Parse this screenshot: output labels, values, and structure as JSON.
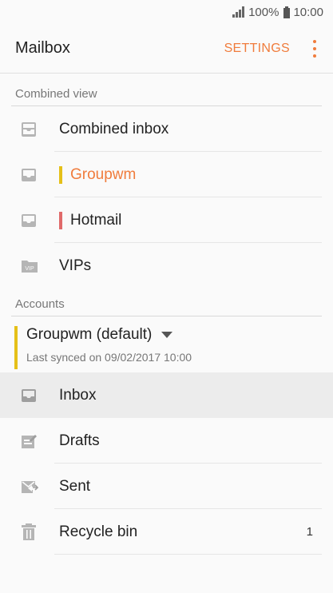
{
  "status": {
    "battery": "100%",
    "time": "10:00"
  },
  "appbar": {
    "title": "Mailbox",
    "settings": "SETTINGS"
  },
  "combined": {
    "header": "Combined view",
    "items": [
      {
        "label": "Combined inbox",
        "icon": "combined-inbox-icon"
      },
      {
        "label": "Groupwm",
        "icon": "inbox-icon",
        "color": "#e5c018"
      },
      {
        "label": "Hotmail",
        "icon": "inbox-icon",
        "color": "#e06a6a"
      },
      {
        "label": "VIPs",
        "icon": "vip-folder-icon"
      }
    ]
  },
  "accounts": {
    "header": "Accounts",
    "account_name": "Groupwm (default)",
    "last_synced": "Last synced on 09/02/2017  10:00",
    "folders": [
      {
        "label": "Inbox",
        "icon": "inbox-icon"
      },
      {
        "label": "Drafts",
        "icon": "drafts-icon"
      },
      {
        "label": "Sent",
        "icon": "sent-icon"
      },
      {
        "label": "Recycle bin",
        "icon": "trash-icon",
        "count": "1"
      }
    ]
  },
  "colors": {
    "accent": "#f07c3c",
    "groupwm": "#e5c018",
    "hotmail": "#e06a6a"
  }
}
